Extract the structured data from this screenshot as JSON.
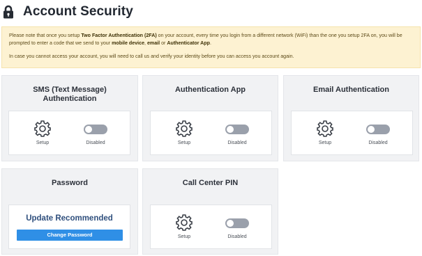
{
  "page": {
    "title": "Account Security",
    "icon": "lock-icon"
  },
  "notice": {
    "line1_a": "Please note that once you setup ",
    "line1_b": "Two Factor Authentication (2FA)",
    "line1_c": " on your account, every time you login from a different network (WiFi) than the one you setup 2FA on, you will be prompted to enter a code that we send to your ",
    "line1_d": "mobile device",
    "line1_e": ", ",
    "line1_f": "email",
    "line1_g": " or ",
    "line1_h": "Authenticator App",
    "line1_i": ".",
    "line2": "In case you cannot access your account, you will need to call us and verify your identity before you can access you account again."
  },
  "cards": {
    "sms": {
      "title_line1": "SMS (Text Message)",
      "title_line2": "Authentication",
      "setup_label": "Setup",
      "status_label": "Disabled"
    },
    "app": {
      "title": "Authentication App",
      "setup_label": "Setup",
      "status_label": "Disabled"
    },
    "email": {
      "title": "Email Authentication",
      "setup_label": "Setup",
      "status_label": "Disabled"
    },
    "password": {
      "title": "Password",
      "recommendation": "Update Recommended",
      "button_label": "Change Password"
    },
    "pin": {
      "title": "Call Center PIN",
      "setup_label": "Setup",
      "status_label": "Disabled"
    }
  },
  "colors": {
    "notice_bg": "#fdf2d2",
    "card_bg": "#f1f2f4",
    "toggle_off": "#9aa0ab",
    "primary_button": "#2f8fe6",
    "recommend_text": "#2f4f7d"
  }
}
